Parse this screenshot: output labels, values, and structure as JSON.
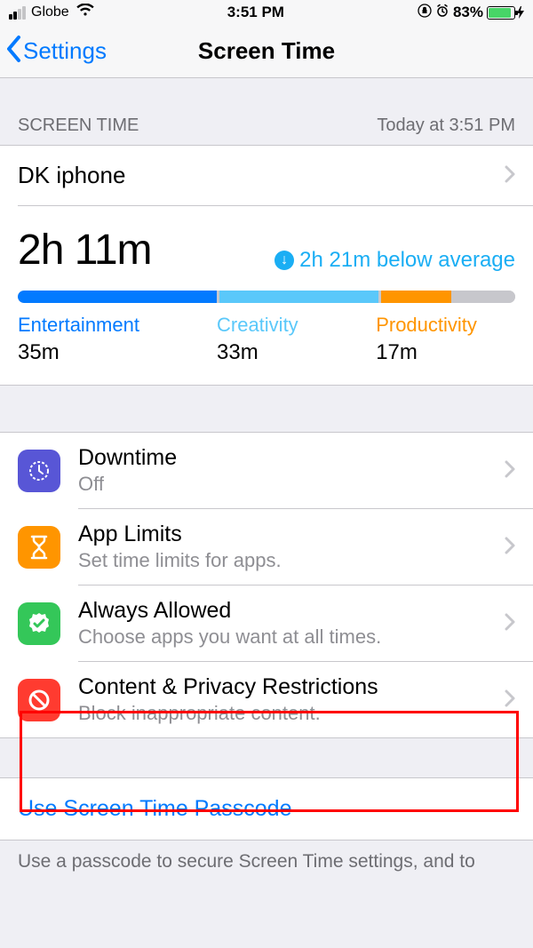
{
  "status": {
    "carrier": "Globe",
    "time": "3:51 PM",
    "battery_pct": "83%"
  },
  "nav": {
    "back": "Settings",
    "title": "Screen Time"
  },
  "section": {
    "header_left": "SCREEN TIME",
    "header_right": "Today at 3:51 PM"
  },
  "device": {
    "name": "DK iphone"
  },
  "usage": {
    "total": "2h 11m",
    "compare": "2h 21m below average"
  },
  "categories": {
    "ent": {
      "label": "Entertainment",
      "time": "35m"
    },
    "cre": {
      "label": "Creativity",
      "time": "33m"
    },
    "pro": {
      "label": "Productivity",
      "time": "17m"
    }
  },
  "features": {
    "downtime": {
      "title": "Downtime",
      "sub": "Off"
    },
    "limits": {
      "title": "App Limits",
      "sub": "Set time limits for apps."
    },
    "allowed": {
      "title": "Always Allowed",
      "sub": "Choose apps you want at all times."
    },
    "content": {
      "title": "Content & Privacy Restrictions",
      "sub": "Block inappropriate content."
    }
  },
  "passcode": {
    "button": "Use Screen Time Passcode",
    "footer": "Use a passcode to secure Screen Time settings, and to"
  }
}
